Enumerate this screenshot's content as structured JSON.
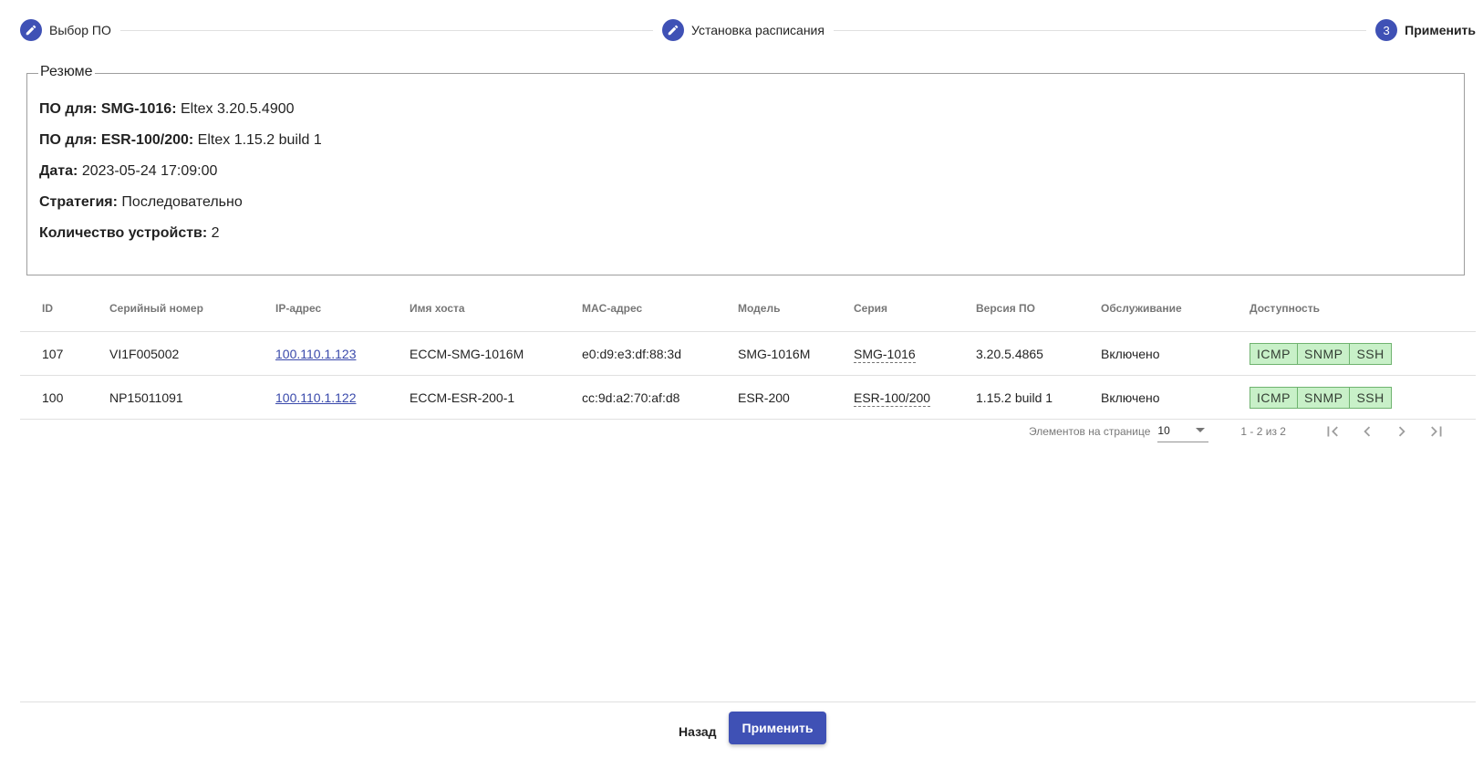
{
  "stepper": {
    "steps": [
      {
        "label": "Выбор ПО",
        "icon": "edit-icon"
      },
      {
        "label": "Установка расписания",
        "icon": "edit-icon"
      },
      {
        "label": "Применить",
        "number": "3"
      }
    ]
  },
  "summary": {
    "legend": "Резюме",
    "rows": [
      {
        "label": "ПО для: SMG-1016:",
        "value": "Eltex 3.20.5.4900"
      },
      {
        "label": "ПО для: ESR-100/200:",
        "value": "Eltex 1.15.2 build 1"
      },
      {
        "label": "Дата:",
        "value": "2023-05-24 17:09:00"
      },
      {
        "label": "Стратегия:",
        "value": "Последовательно"
      },
      {
        "label": "Количество устройств:",
        "value": "2"
      }
    ]
  },
  "table": {
    "headers": [
      "ID",
      "Серийный номер",
      "IP-адрес",
      "Имя хоста",
      "MAC-адрес",
      "Модель",
      "Серия",
      "Версия ПО",
      "Обслуживание",
      "Доступность"
    ],
    "rows": [
      {
        "id": "107",
        "serial": "VI1F005002",
        "ip": "100.110.1.123",
        "host": "ECCM-SMG-1016M",
        "mac": "e0:d9:e3:df:88:3d",
        "model": "SMG-1016M",
        "series": "SMG-1016",
        "version": "3.20.5.4865",
        "service": "Включено",
        "access": [
          "ICMP",
          "SNMP",
          "SSH"
        ]
      },
      {
        "id": "100",
        "serial": "NP15011091",
        "ip": "100.110.1.122",
        "host": "ECCM-ESR-200-1",
        "mac": "cc:9d:a2:70:af:d8",
        "model": "ESR-200",
        "series": "ESR-100/200",
        "version": "1.15.2 build 1",
        "service": "Включено",
        "access": [
          "ICMP",
          "SNMP",
          "SSH"
        ]
      }
    ]
  },
  "paginator": {
    "label": "Элементов на странице",
    "page_size": "10",
    "range": "1 - 2 из 2"
  },
  "footer": {
    "back_label": "Назад",
    "apply_label": "Применить"
  },
  "colors": {
    "primary": "#3f51b5",
    "link": "#3949ab",
    "badge_bg": "#c8f0c8",
    "badge_border": "#6fb36f"
  }
}
